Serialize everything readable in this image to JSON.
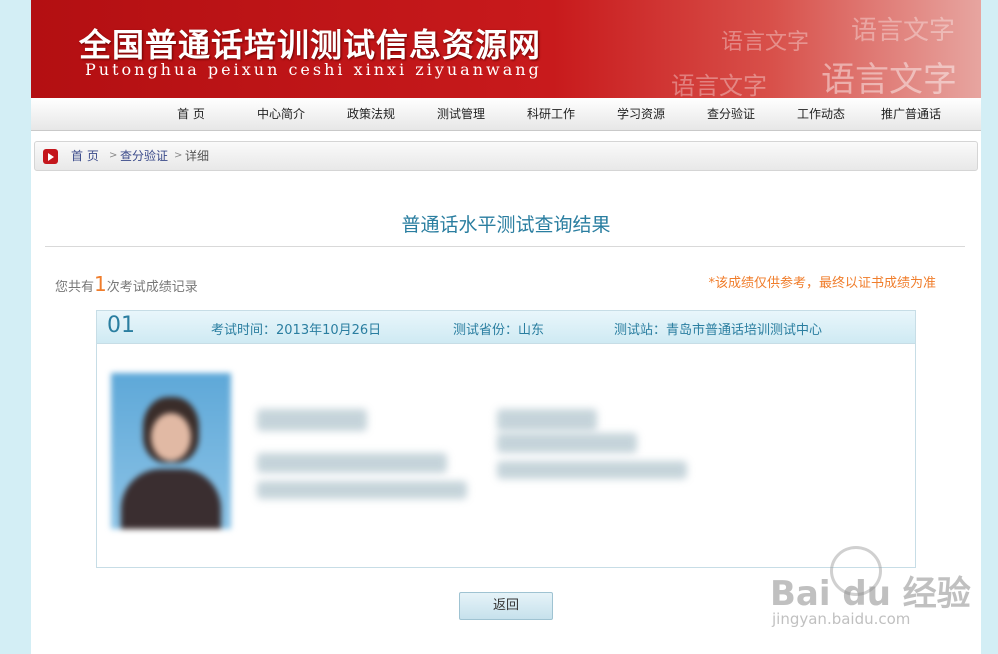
{
  "banner": {
    "title": "全国普通话培训测试信息资源网",
    "subtitle": "Putonghua peixun ceshi xinxi ziyuanwang"
  },
  "nav": [
    {
      "label": "首  页"
    },
    {
      "label": "中心简介"
    },
    {
      "label": "政策法规"
    },
    {
      "label": "测试管理"
    },
    {
      "label": "科研工作"
    },
    {
      "label": "学习资源"
    },
    {
      "label": "查分验证"
    },
    {
      "label": "工作动态"
    },
    {
      "label": "推广普通话"
    }
  ],
  "breadcrumb": {
    "home": "首 页",
    "sep": ">",
    "section": "查分验证",
    "current": "详细"
  },
  "result": {
    "title": "普通话水平测试查询结果",
    "record_prefix": "您共有",
    "record_count": "1",
    "record_suffix": "次考试成绩记录",
    "notice": "*该成绩仅供参考，最终以证书成绩为准"
  },
  "card": {
    "number": "01",
    "exam_time": "考试时间：2013年10月26日",
    "province": "测试省份：山东",
    "station": "测试站：青岛市普通话培训测试中心"
  },
  "back_button": "返回",
  "watermark": {
    "logo": "Bai du 经验",
    "url": "jingyan.baidu.com"
  },
  "colors": {
    "banner_red": "#c81a1c",
    "accent_blue": "#2a7ea0",
    "notice_orange": "#f07d2b",
    "page_bg": "#d3eef5"
  }
}
